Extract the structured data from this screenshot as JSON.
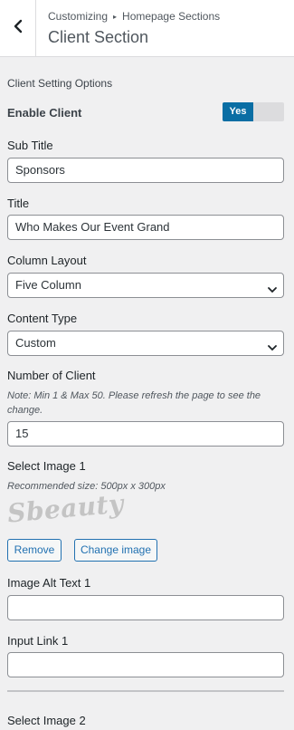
{
  "header": {
    "breadcrumb": [
      "Customizing",
      "Homepage Sections"
    ],
    "breadcrumb_sep": "▸",
    "title": "Client Section"
  },
  "group_title": "Client Setting Options",
  "enable_client": {
    "label": "Enable Client",
    "toggle_on": "Yes",
    "value": true
  },
  "sub_title": {
    "label": "Sub Title",
    "value": "Sponsors"
  },
  "title": {
    "label": "Title",
    "value": "Who Makes Our Event Grand"
  },
  "column_layout": {
    "label": "Column Layout",
    "value": "Five Column"
  },
  "content_type": {
    "label": "Content Type",
    "value": "Custom"
  },
  "number_of_client": {
    "label": "Number of Client",
    "note": "Note: Min 1 & Max 50. Please refresh the page to see the change.",
    "value": "15"
  },
  "select_image_1": {
    "label": "Select Image 1",
    "note": "Recommended size: 500px x 300px",
    "logo_text": "Sbeauty",
    "remove_label": "Remove",
    "change_label": "Change image"
  },
  "image_alt_text_1": {
    "label": "Image Alt Text 1",
    "value": ""
  },
  "input_link_1": {
    "label": "Input Link 1",
    "value": ""
  },
  "select_image_2": {
    "label": "Select Image 2"
  },
  "colors": {
    "accent": "#2271b1",
    "toggle_on": "#0a6ea4",
    "panel_bg": "#f0f0f1"
  }
}
